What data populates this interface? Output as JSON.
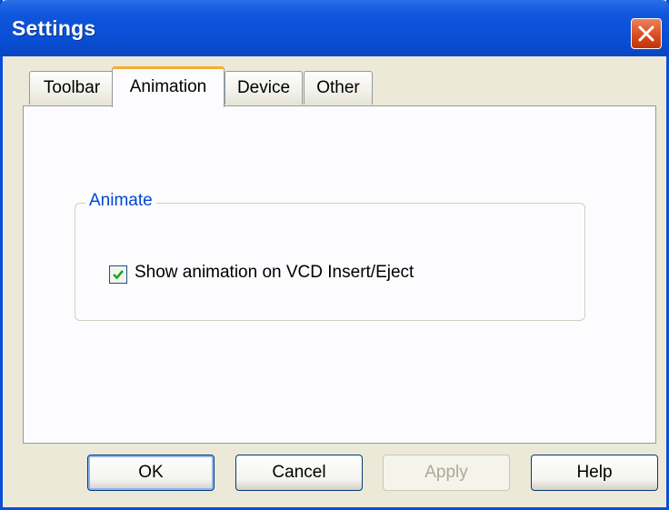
{
  "window": {
    "title": "Settings"
  },
  "tabs": [
    {
      "label": "Toolbar"
    },
    {
      "label": "Animation",
      "active": true
    },
    {
      "label": "Device"
    },
    {
      "label": "Other"
    }
  ],
  "group": {
    "label": "Animate",
    "checkbox_label": "Show animation on VCD Insert/Eject",
    "checked": true
  },
  "buttons": {
    "ok": "OK",
    "cancel": "Cancel",
    "apply": "Apply",
    "help": "Help"
  },
  "icons": {
    "close": "close-icon",
    "check": "check-icon"
  },
  "colors": {
    "titlebar": "#0a4ed4",
    "active_tab_accent": "#f7ad30",
    "group_label": "#0046d5",
    "close_button": "#d9491c"
  }
}
